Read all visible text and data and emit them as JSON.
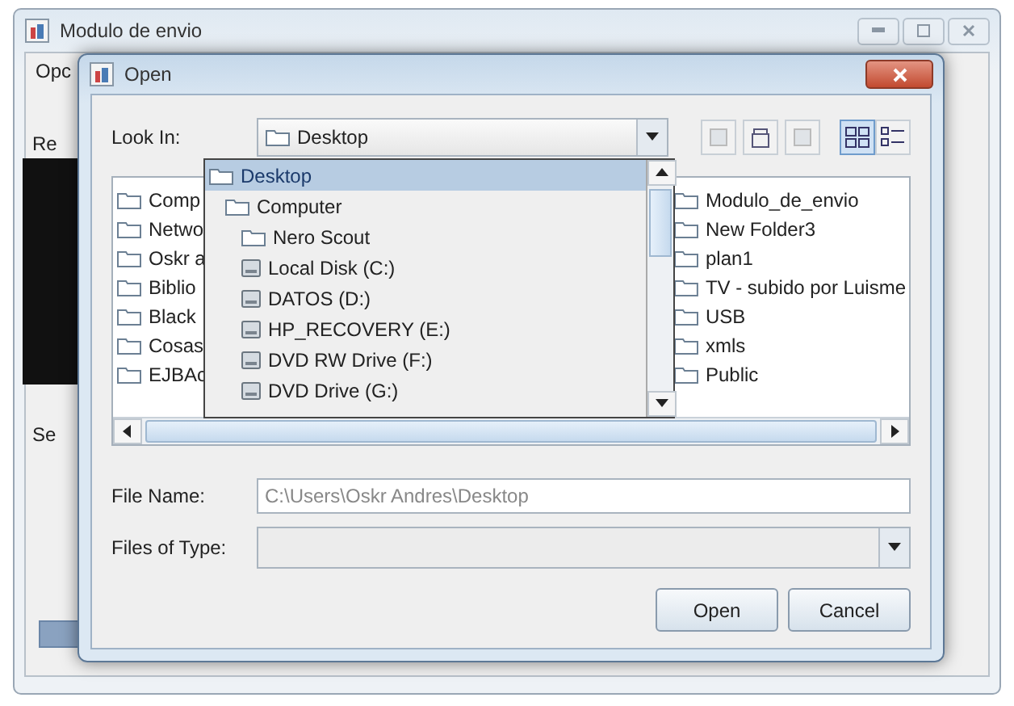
{
  "main_window": {
    "title": "Modulo de envio",
    "menu": [
      {
        "label": "Opc"
      }
    ],
    "side_labels": [
      "Re",
      "Se"
    ]
  },
  "dialog": {
    "title": "Open",
    "look_in": {
      "label": "Look In:",
      "value": "Desktop"
    },
    "view_modes": [
      {
        "kind": "list",
        "selected": true
      },
      {
        "kind": "details",
        "selected": false
      }
    ],
    "files": [
      {
        "name": "Comp",
        "kind": "folder"
      },
      {
        "name": "Netwo",
        "kind": "folder"
      },
      {
        "name": "Oskr a",
        "kind": "folder"
      },
      {
        "name": "Biblio",
        "kind": "folder"
      },
      {
        "name": "Black",
        "kind": "folder"
      },
      {
        "name": "Cosas",
        "kind": "folder"
      },
      {
        "name": "EJBAc",
        "kind": "folder"
      },
      {
        "name": "Modulo_de_envio",
        "kind": "folder"
      },
      {
        "name": "New Folder3",
        "kind": "folder"
      },
      {
        "name": "plan1",
        "kind": "folder"
      },
      {
        "name": "TV - subido por Luisme",
        "kind": "folder"
      },
      {
        "name": "USB",
        "kind": "folder"
      },
      {
        "name": "xmls",
        "kind": "folder"
      },
      {
        "name": "Public",
        "kind": "folder"
      }
    ],
    "look_in_popup": [
      {
        "name": "Desktop",
        "kind": "folder",
        "selected": true,
        "children": [
          {
            "name": "Computer",
            "kind": "folder",
            "selected": false,
            "children": [
              {
                "name": "Nero Scout",
                "kind": "folder",
                "selected": false
              },
              {
                "name": "Local Disk (C:)",
                "kind": "drive",
                "selected": false
              },
              {
                "name": "DATOS (D:)",
                "kind": "drive",
                "selected": false
              },
              {
                "name": "HP_RECOVERY (E:)",
                "kind": "drive",
                "selected": false
              },
              {
                "name": "DVD RW Drive (F:)",
                "kind": "drive",
                "selected": false
              },
              {
                "name": "DVD Drive (G:)",
                "kind": "drive",
                "selected": false
              }
            ]
          }
        ]
      }
    ],
    "file_name": {
      "label": "File Name:",
      "value": "C:\\Users\\Oskr Andres\\Desktop"
    },
    "files_of_type": {
      "label": "Files of Type:"
    },
    "buttons": [
      "Open",
      "Cancel"
    ]
  }
}
